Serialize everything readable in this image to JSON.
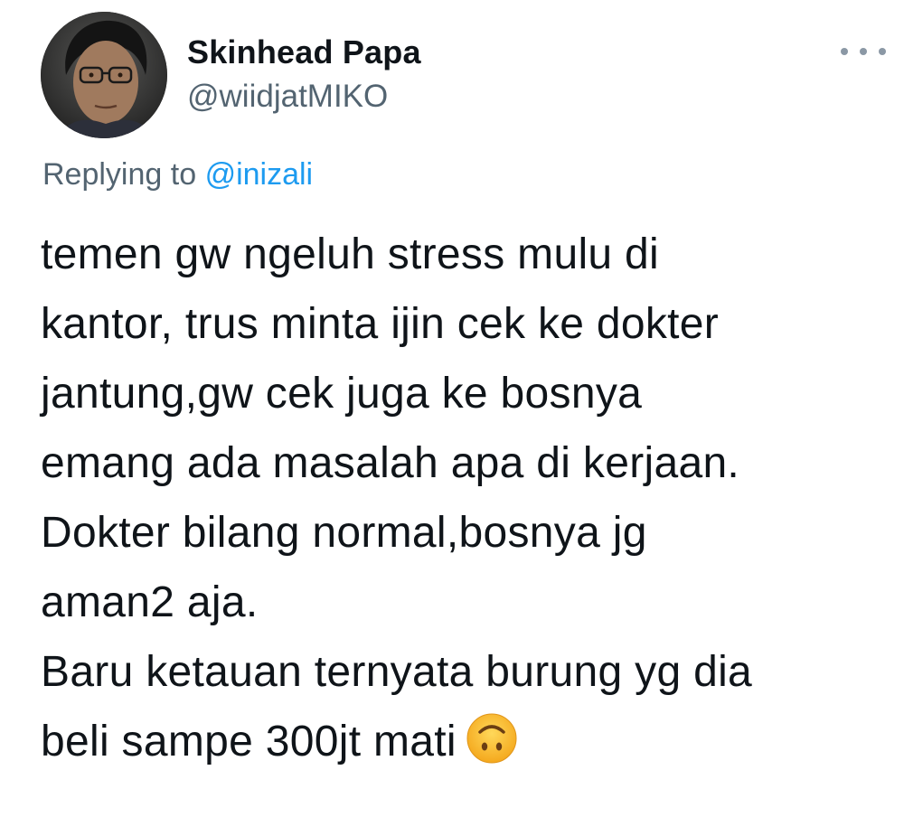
{
  "author": {
    "display_name": "Skinhead Papa",
    "handle": "@wiidjatMIKO",
    "avatar": "profile-photo"
  },
  "reply_context": {
    "prefix": "Replying to",
    "mention": "@inizali"
  },
  "tweet": {
    "lines": [
      "temen gw ngeluh stress mulu di",
      "kantor, trus minta ijin cek ke dokter",
      "jantung,gw cek juga ke bosnya",
      "emang ada masalah apa di kerjaan.",
      "Dokter bilang normal,bosnya jg",
      "aman2 aja.",
      "Baru ketauan ternyata burung yg dia",
      "beli sampe 300jt mati"
    ],
    "trailing_emoji": "upside-down-face-emoji"
  },
  "icons": {
    "more": "more-horizontal-icon"
  },
  "colors": {
    "text_primary": "#0f1419",
    "text_secondary": "#536471",
    "accent": "#1d9bf0",
    "more_dots": "#8b98a5"
  }
}
